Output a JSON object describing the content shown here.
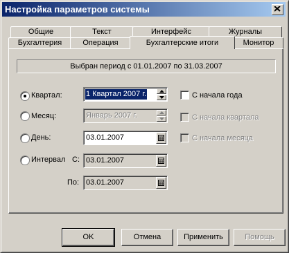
{
  "window": {
    "title": "Настройка параметров системы"
  },
  "tabs_row1": [
    "Общие",
    "Текст",
    "Интерфейс",
    "Журналы"
  ],
  "tabs_row2": [
    "Бухгалтерия",
    "Операция",
    "Бухгалтерские итоги",
    "Монитор"
  ],
  "active_tab": "Бухгалтерские итоги",
  "period_text": "Выбран период с 01.01.2007 по 31.03.2007",
  "options": {
    "quarter": {
      "label": "Квартал:",
      "value": "1 Квартал 2007 г.",
      "selected": true
    },
    "month": {
      "label": "Месяц:",
      "value": "Январь 2007 г.",
      "disabled": true
    },
    "day": {
      "label": "День:",
      "value": "03.01.2007"
    },
    "interval": {
      "label": "Интервал",
      "from_label": "С:",
      "from_value": "03.01.2007",
      "to_label": "По:",
      "to_value": "03.01.2007"
    }
  },
  "checkboxes": {
    "year_start": {
      "label": "С начала года",
      "checked": false,
      "disabled": false
    },
    "quarter_start": {
      "label": "С начала квартала",
      "checked": false,
      "disabled": true
    },
    "month_start": {
      "label": "С начала месяца",
      "checked": false,
      "disabled": true
    }
  },
  "buttons": {
    "ok": "OK",
    "cancel": "Отмена",
    "apply": "Применить",
    "help": "Помощь"
  }
}
